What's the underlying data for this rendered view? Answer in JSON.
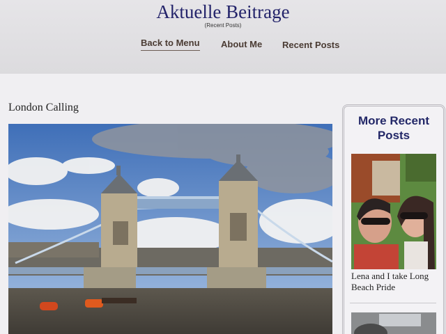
{
  "site": {
    "title": "Aktuelle Beitrage",
    "subtitle": "(Recent Posts)"
  },
  "nav": {
    "items": [
      {
        "label": "Back to Menu",
        "active": true
      },
      {
        "label": "About Me"
      },
      {
        "label": "Recent Posts"
      }
    ]
  },
  "post": {
    "title": "London Calling",
    "image": "tower-bridge-photo"
  },
  "sidebar": {
    "title": "More Recent Posts",
    "posts": [
      {
        "caption": "Lena and I take Long Beach Pride",
        "image": "selfie-photo"
      },
      {
        "caption": "",
        "image": "car-photo"
      }
    ]
  },
  "colors": {
    "title": "#23236a",
    "nav_text": "#4a3b33",
    "sidebar_title": "#232868"
  }
}
